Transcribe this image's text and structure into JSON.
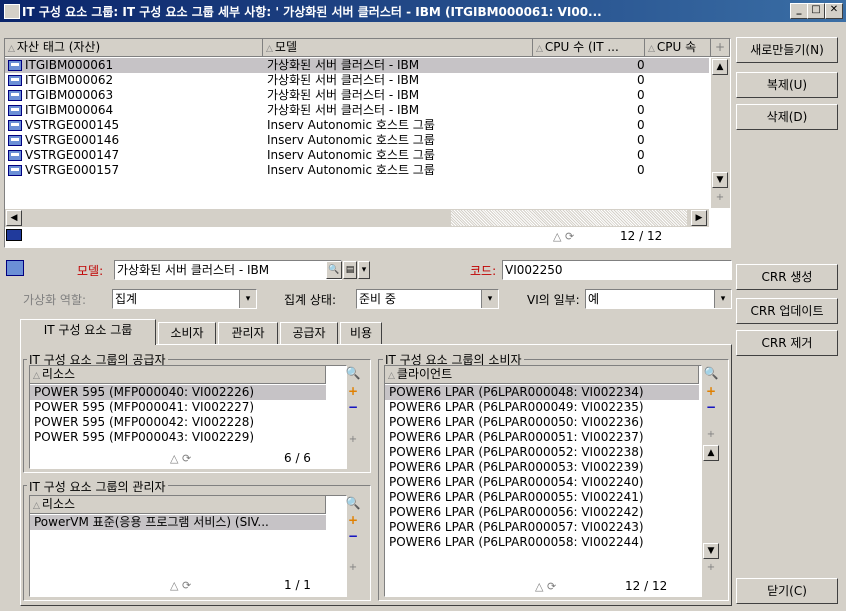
{
  "window": {
    "title": "IT 구성 요소 그룹: IT 구성 요소 그룹 세부 사항: ' 가상화된 서버 클러스터 - IBM (ITGIBM000061: VI00...",
    "min": "_",
    "max": "□",
    "close": "✕"
  },
  "top_list": {
    "columns": [
      "자산 태그 (자산)",
      "모델",
      "CPU 수 (IT ...",
      "CPU 속"
    ],
    "rows": [
      {
        "tag": "ITGIBM000061",
        "model": "가상화된 서버 클러스터 - IBM",
        "cpu": "0"
      },
      {
        "tag": "ITGIBM000062",
        "model": "가상화된 서버 클러스터 - IBM",
        "cpu": "0"
      },
      {
        "tag": "ITGIBM000063",
        "model": "가상화된 서버 클러스터 - IBM",
        "cpu": "0"
      },
      {
        "tag": "ITGIBM000064",
        "model": "가상화된 서버 클러스터 - IBM",
        "cpu": "0"
      },
      {
        "tag": "VSTRGE000145",
        "model": "Inserv Autonomic 호스트 그룹",
        "cpu": "0"
      },
      {
        "tag": "VSTRGE000146",
        "model": "Inserv Autonomic 호스트 그룹",
        "cpu": "0"
      },
      {
        "tag": "VSTRGE000147",
        "model": "Inserv Autonomic 호스트 그룹",
        "cpu": "0"
      },
      {
        "tag": "VSTRGE000157",
        "model": "Inserv Autonomic 호스트 그룹",
        "cpu": "0"
      }
    ],
    "selected_index": 0,
    "counter": "12 / 12"
  },
  "side_buttons": {
    "new": "새로만들기(N)",
    "copy": "복제(U)",
    "delete": "삭제(D)"
  },
  "detail": {
    "model_label": "모델:",
    "model_value": "가상화된 서버 클러스터 - IBM",
    "code_label": "코드:",
    "code_value": "VI002250",
    "virt_role_label": "가상화 역할:",
    "virt_role_value": "집계",
    "agg_status_label": "집계 상태:",
    "agg_status_value": "준비 중",
    "vi_part_label": "VI의 일부:",
    "vi_part_value": "예"
  },
  "crr_buttons": {
    "create": "CRR 생성",
    "update": "CRR 업데이트",
    "remove": "CRR 제거"
  },
  "tabs": [
    "IT 구성 요소 그룹",
    "소비자",
    "관리자",
    "공급자",
    "비용"
  ],
  "active_tab": 0,
  "suppliers": {
    "title": "IT 구성 요소 그룹의 공급자",
    "column": "리소스",
    "rows": [
      "POWER 595 (MFP000040: VI002226)",
      "POWER 595 (MFP000041: VI002227)",
      "POWER 595 (MFP000042: VI002228)",
      "POWER 595 (MFP000043: VI002229)"
    ],
    "counter": "6 / 6"
  },
  "managers": {
    "title": "IT 구성 요소 그룹의 관리자",
    "column": "리소스",
    "rows": [
      "PowerVM 표준(응용 프로그램 서비스) (SIV..."
    ],
    "counter": "1 / 1"
  },
  "consumers": {
    "title": "IT 구성 요소 그룹의 소비자",
    "column": "클라이언트",
    "rows": [
      "POWER6 LPAR (P6LPAR000048: VI002234)",
      "POWER6 LPAR (P6LPAR000049: VI002235)",
      "POWER6 LPAR (P6LPAR000050: VI002236)",
      "POWER6 LPAR (P6LPAR000051: VI002237)",
      "POWER6 LPAR (P6LPAR000052: VI002238)",
      "POWER6 LPAR (P6LPAR000053: VI002239)",
      "POWER6 LPAR (P6LPAR000054: VI002240)",
      "POWER6 LPAR (P6LPAR000055: VI002241)",
      "POWER6 LPAR (P6LPAR000056: VI002242)",
      "POWER6 LPAR (P6LPAR000057: VI002243)",
      "POWER6 LPAR (P6LPAR000058: VI002244)"
    ],
    "counter": "12 / 12"
  },
  "close_button": "닫기(C)",
  "icons": {
    "plus": "+",
    "minus": "−",
    "search": "🔍",
    "up": "▲",
    "down": "▼",
    "left": "◀",
    "right": "▶",
    "dropdown": "▾",
    "sort": "△"
  }
}
